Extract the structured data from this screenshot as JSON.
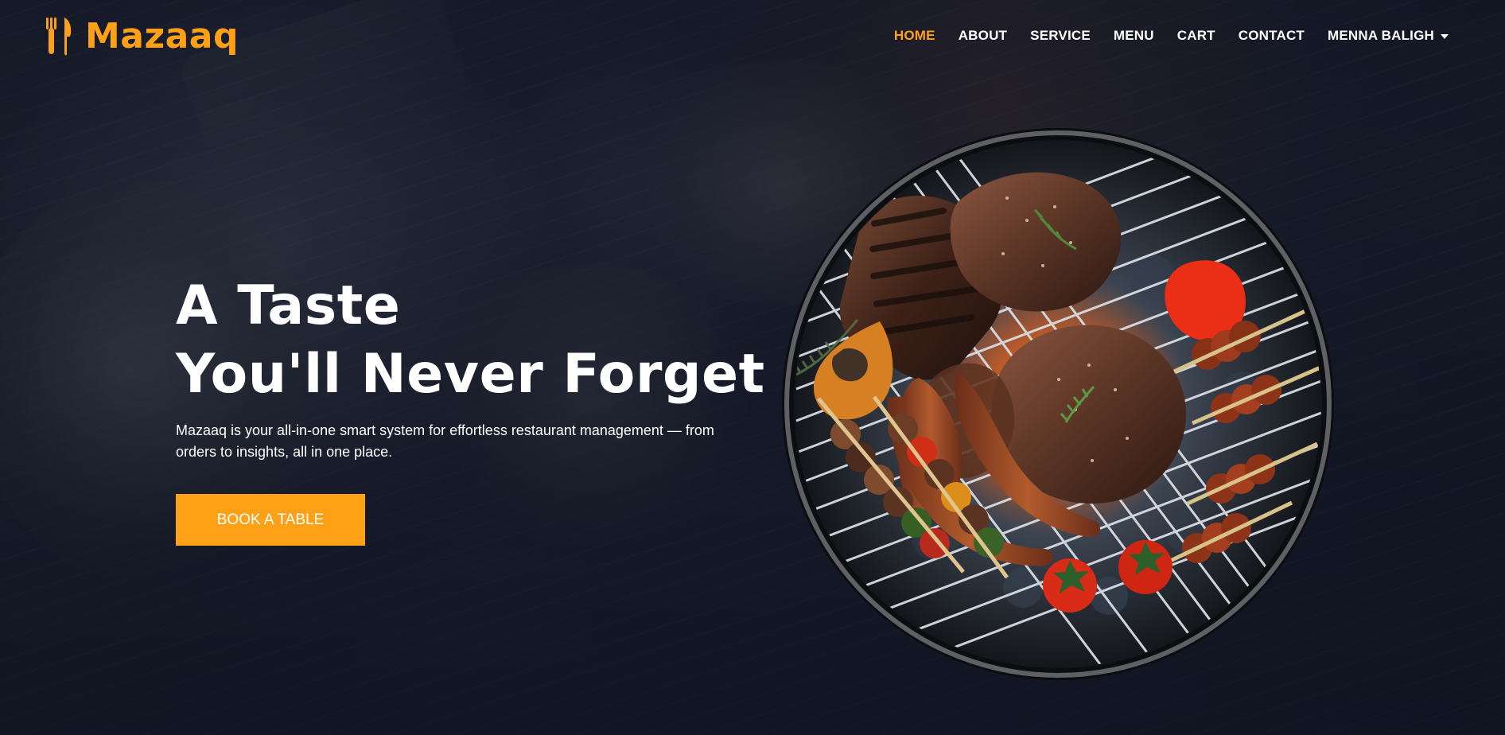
{
  "brand": {
    "name": "Mazaaq",
    "icon": "utensils-icon",
    "accent_color": "#fea116"
  },
  "nav": {
    "items": [
      {
        "label": "HOME",
        "active": true
      },
      {
        "label": "ABOUT",
        "active": false
      },
      {
        "label": "SERVICE",
        "active": false
      },
      {
        "label": "MENU",
        "active": false
      },
      {
        "label": "CART",
        "active": false
      },
      {
        "label": "CONTACT",
        "active": false
      }
    ],
    "user": {
      "label": "MENNA BALIGH",
      "icon": "caret-down-icon"
    }
  },
  "hero": {
    "title_line_1": "A Taste",
    "title_line_2": "You'll Never Forget",
    "description": "Mazaaq is your all-in-one smart system for effortless restaurant management — from orders to insights, all in one place.",
    "cta_label": "BOOK A TABLE",
    "image_icon": "grilled-food-image"
  },
  "colors": {
    "background": "#1a1e2f",
    "text": "#ffffff",
    "accent": "#fea116"
  }
}
